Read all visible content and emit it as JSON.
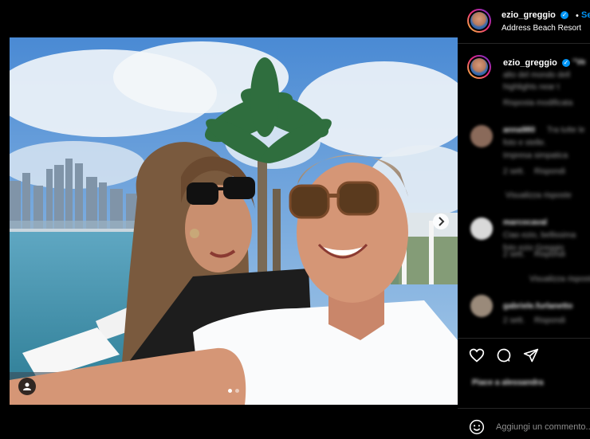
{
  "post": {
    "username": "ezio_greggio",
    "follow_label": "Se",
    "location": "Address Beach Resort",
    "carousel": {
      "current": 1,
      "total": 2
    }
  },
  "caption": {
    "username": "ezio_greggio",
    "text_lines": [
      "\"Ve",
      "alto del mondo dell",
      "highlights near t"
    ],
    "meta": "Risposta modificata"
  },
  "comments": [
    {
      "user": "anna980",
      "lines": [
        "Tra tutte le",
        "foto e stelle.",
        "Impresa simpatica"
      ],
      "time": "2 sett.",
      "action": "Rispondi"
    },
    {
      "user": "marcocaval",
      "lines": [
        "Ciao ezio, bellissima",
        "foto ezio Greggio"
      ],
      "time": "2 sett.",
      "action": "Rispondi"
    },
    {
      "user": "gabriele.furlanetto",
      "lines": [],
      "time": "2 sett.",
      "action": "Rispondi"
    }
  ],
  "view_replies": [
    "Visualizza risposte",
    "Visualizza risposte"
  ],
  "likes_text": "Piace a alessandra",
  "add_comment_placeholder": "Aggiungi un commento...",
  "icons": {
    "like": "heart-icon",
    "comment": "comment-icon",
    "share": "paper-plane-icon",
    "emoji": "emoji-icon",
    "tag": "user-tag-icon",
    "next": "chevron-right-icon"
  },
  "colors": {
    "accent": "#0095f6",
    "background": "#000000",
    "divider": "#262626"
  }
}
